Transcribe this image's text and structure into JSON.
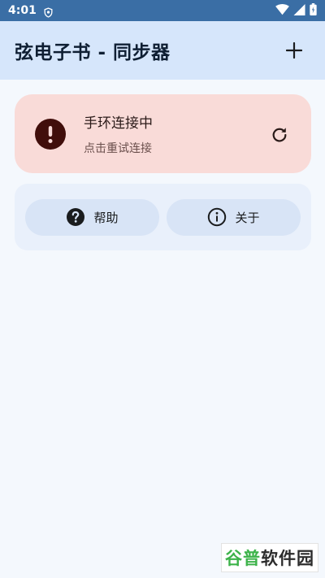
{
  "status_bar": {
    "time": "4:01",
    "icons": [
      "shield-icon",
      "wifi-icon",
      "signal-icon",
      "battery-icon"
    ]
  },
  "app_bar": {
    "title": "弦电子书 - 同步器",
    "add_icon": "plus-icon"
  },
  "connection_card": {
    "title": "手环连接中",
    "subtitle": "点击重试连接",
    "status_icon": "alert-icon",
    "action_icon": "refresh-icon",
    "background": "#f9dbd8",
    "icon_color": "#410e0b"
  },
  "actions": {
    "help": {
      "label": "帮助",
      "icon": "help-icon"
    },
    "about": {
      "label": "关于",
      "icon": "info-icon"
    }
  },
  "watermark": {
    "part1": "谷普",
    "part2": "软件园",
    "color1": "#3db34a",
    "color2": "#2c2c2c"
  },
  "colors": {
    "status_bar": "#3a6ea5",
    "app_bar": "#d6e6fb",
    "background": "#f4f8fd",
    "pill": "#d8e4f6"
  }
}
